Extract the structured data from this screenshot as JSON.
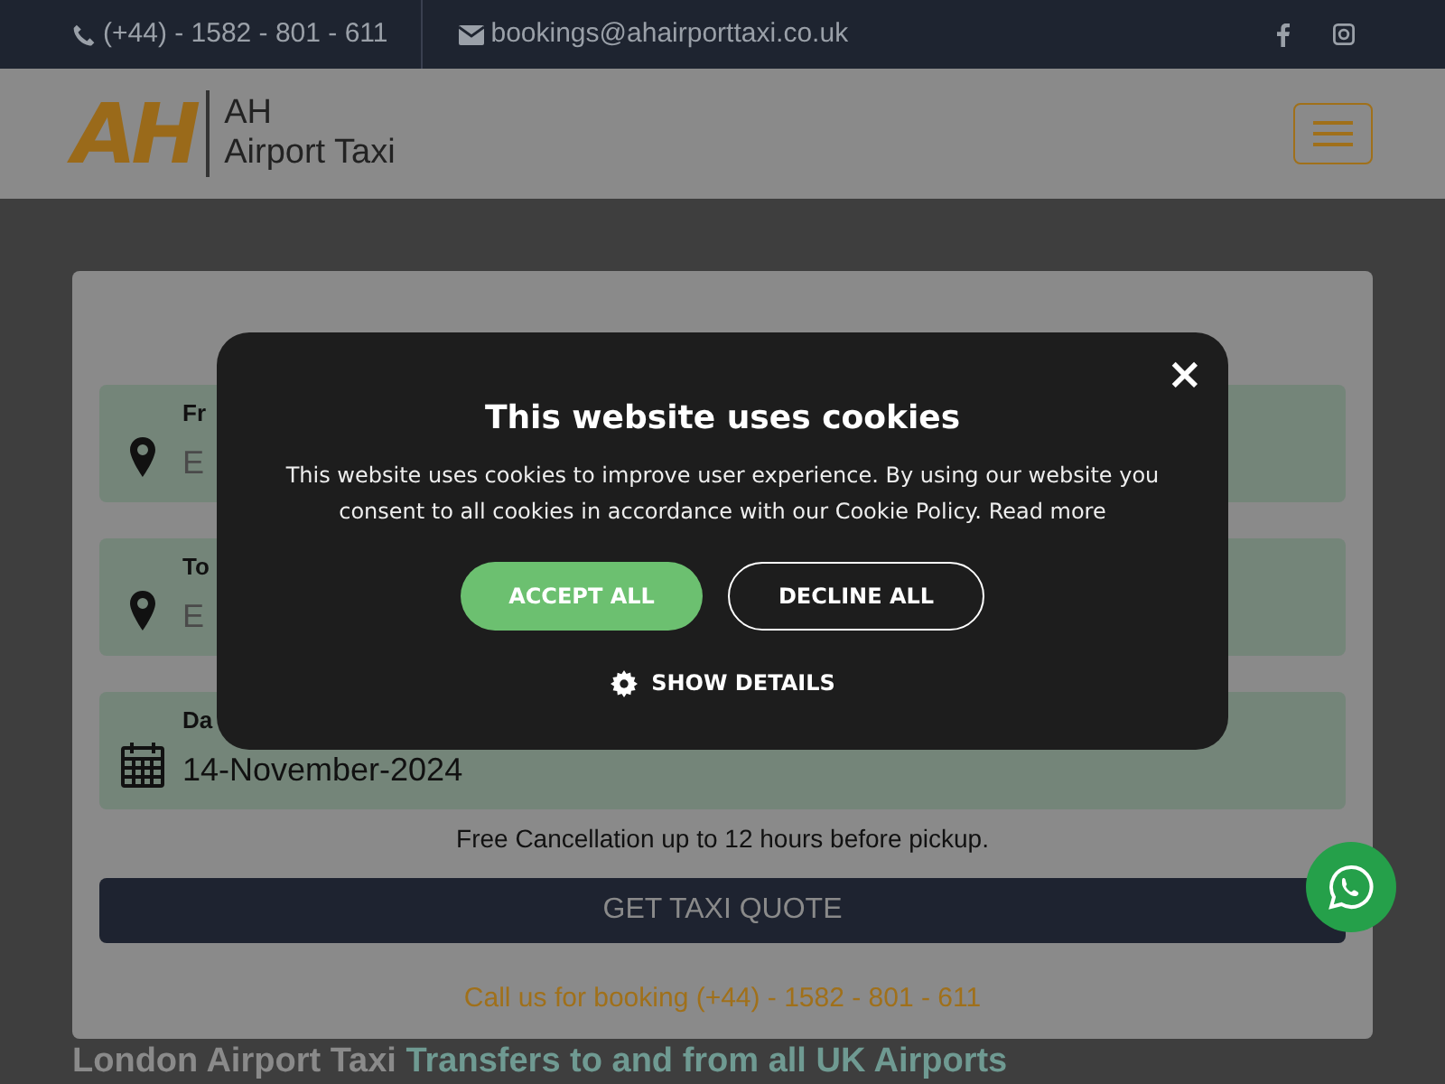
{
  "top_bar": {
    "phone": "(+44) - 1582 - 801 - 611",
    "email": "bookings@ahairporttaxi.co.uk"
  },
  "header": {
    "logo_mark": "AH",
    "logo_line_1": "AH",
    "logo_line_2": "Airport Taxi"
  },
  "quote_form": {
    "fields": [
      {
        "kind": "location",
        "label": "Fr",
        "placeholder": "E"
      },
      {
        "kind": "location",
        "label": "To",
        "placeholder": "E"
      },
      {
        "kind": "date",
        "label": "Da",
        "value": "14-November-2024"
      }
    ],
    "note": "Free Cancellation up to 12 hours before pickup.",
    "submit": "GET TAXI QUOTE",
    "call_line": "Call us for booking (+44) - 1582 - 801 - 611"
  },
  "section_heading": {
    "part_1": "London Airport Taxi",
    "part_2": "Transfers to and from all UK Airports"
  },
  "cookie_dialog": {
    "close": "×",
    "title": "This website uses cookies",
    "text": "This website uses cookies to improve user experience. By using our website you consent to all cookies in accordance with our Cookie Policy.",
    "link": "Read more",
    "accept": "ACCEPT ALL",
    "decline": "DECLINE ALL",
    "details": "SHOW DETAILS"
  }
}
